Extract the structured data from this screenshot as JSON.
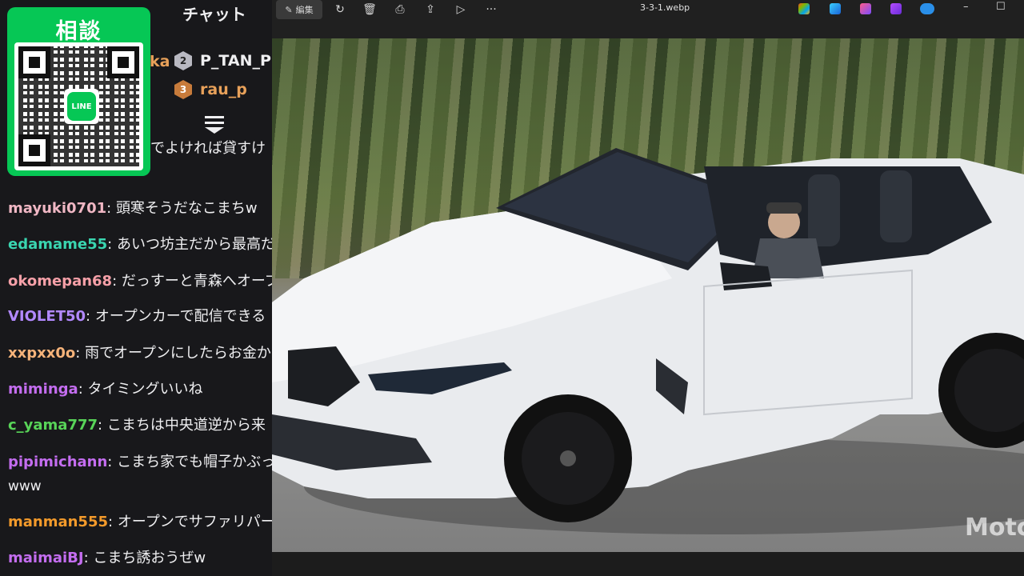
{
  "chat": {
    "title": "チャット",
    "leader_partial": "ka",
    "leaders": [
      {
        "rank": "2",
        "name": "P_TAN_P"
      },
      {
        "rank": "3",
        "name": "rau_p"
      }
    ],
    "first_line_partial": "でよければ貸すけ",
    "messages": [
      {
        "user": "mayuki0701",
        "color": "#f0b7c4",
        "text": "頭寒そうだなこまちw"
      },
      {
        "user": "edamame55",
        "color": "#3ad5b0",
        "text": "あいつ坊主だから最高だ"
      },
      {
        "user": "okomepan68",
        "color": "#f6a0a8",
        "text": "だっすーと青森へオープ"
      },
      {
        "user": "VIOLET50",
        "color": "#b289ff",
        "text": "オープンカーで配信できる"
      },
      {
        "user": "xxpxx0o",
        "color": "#f6b37a",
        "text": "雨でオープンにしたらお金か"
      },
      {
        "user": "miminga",
        "color": "#c46df0",
        "text": "タイミングいいね"
      },
      {
        "user": "c_yama777",
        "color": "#58d458",
        "text": "こまちは中央道逆から来"
      },
      {
        "user": "pipimichann",
        "color": "#c46df0",
        "text": "こまち家でも帽子かぶって"
      },
      {
        "user": "manman555",
        "color": "#f39a2b",
        "text": "オープンでサファリパーク"
      },
      {
        "user": "maimaiBJ",
        "color": "#c46df0",
        "text": "こまち誘おうぜw"
      }
    ],
    "continuation": "www"
  },
  "qr": {
    "label": "相談",
    "logo_text": "LINE",
    "accent": "#06c755"
  },
  "viewer": {
    "edit_label": "編集",
    "file_name": "3-3-1.webp",
    "toolbar_icons": [
      "rotate-icon",
      "trash-icon",
      "print-icon",
      "share-icon",
      "slideshow-icon",
      "more-icon"
    ],
    "watermark": "Motc",
    "window_controls": {
      "minimize": "–",
      "maximize": "☐"
    }
  }
}
